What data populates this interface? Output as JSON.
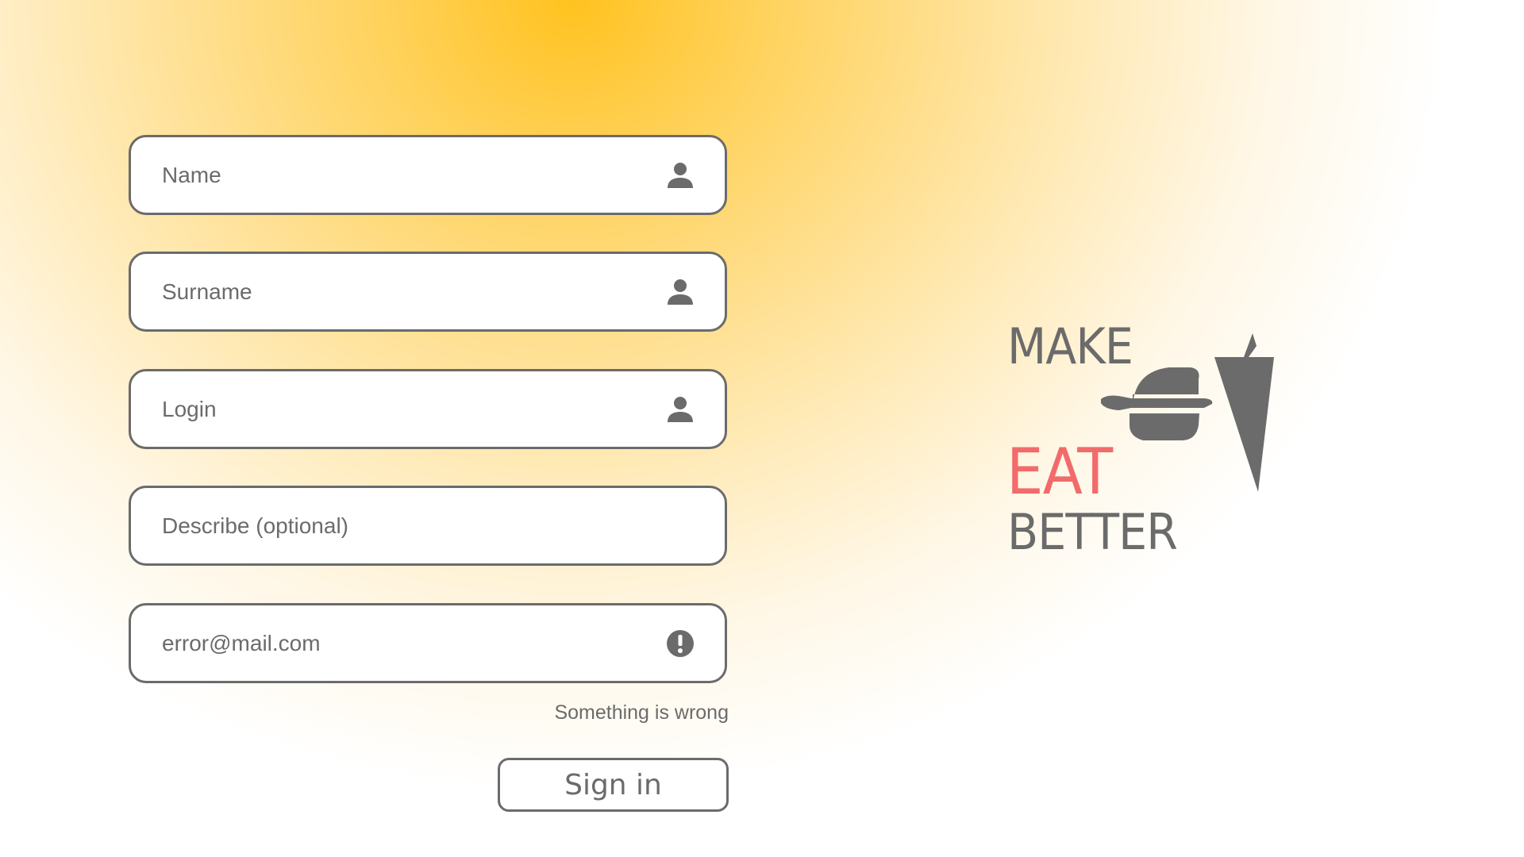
{
  "form": {
    "fields": [
      {
        "name": "name-field",
        "placeholder": "Name",
        "icon": "user-icon"
      },
      {
        "name": "surname-field",
        "placeholder": "Surname",
        "icon": "user-icon"
      },
      {
        "name": "login-field",
        "placeholder": "Login",
        "icon": "user-icon"
      },
      {
        "name": "describe-field",
        "placeholder": "Describe (optional)",
        "icon": ""
      },
      {
        "name": "email-field",
        "placeholder": "error@mail.com",
        "icon": "error-icon"
      }
    ],
    "error_message": "Something is wrong",
    "submit_label": "Sign in"
  },
  "logo": {
    "line1": "MAKE",
    "line2": "EAT",
    "line3": "BETTER",
    "icon": "burger-knife-carrot-icon"
  },
  "colors": {
    "accent": "#ffc21f",
    "text": "#6b6b6b",
    "highlight": "#f26b6b",
    "border": "#6b6b6b"
  }
}
